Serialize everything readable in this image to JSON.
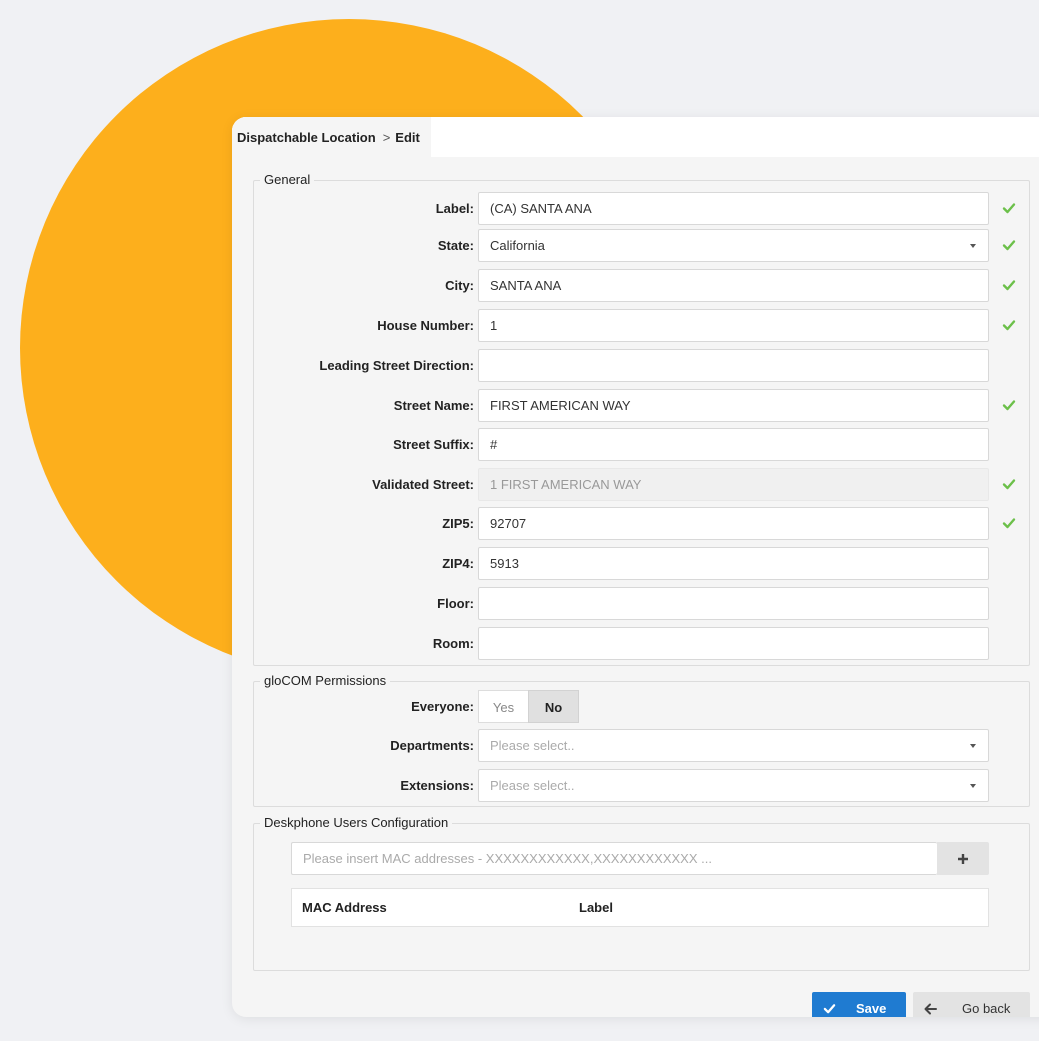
{
  "breadcrumb": {
    "root": "Dispatchable Location",
    "separator": ">",
    "current": "Edit"
  },
  "general": {
    "legend": "General",
    "fields": {
      "label": {
        "label": "Label:",
        "value": "(CA) SANTA ANA"
      },
      "state": {
        "label": "State:",
        "value": "California"
      },
      "city": {
        "label": "City:",
        "value": "SANTA ANA"
      },
      "house_number": {
        "label": "House Number:",
        "value": "1"
      },
      "leading_street_direction": {
        "label": "Leading Street Direction:",
        "value": ""
      },
      "street_name": {
        "label": "Street Name:",
        "value": "FIRST AMERICAN WAY"
      },
      "street_suffix": {
        "label": "Street Suffix:",
        "value": "#"
      },
      "validated_street": {
        "label": "Validated Street:",
        "value": "1 FIRST AMERICAN WAY"
      },
      "zip5": {
        "label": "ZIP5:",
        "value": "92707"
      },
      "zip4": {
        "label": "ZIP4:",
        "value": "5913"
      },
      "floor": {
        "label": "Floor:",
        "value": ""
      },
      "room": {
        "label": "Room:",
        "value": ""
      }
    }
  },
  "permissions": {
    "legend": "gloCOM Permissions",
    "everyone": {
      "label": "Everyone:",
      "yes": "Yes",
      "no": "No",
      "selected": "No"
    },
    "departments": {
      "label": "Departments:",
      "placeholder": "Please select.."
    },
    "extensions": {
      "label": "Extensions:",
      "placeholder": "Please select.."
    }
  },
  "deskphone": {
    "legend": "Deskphone Users Configuration",
    "mac_placeholder": "Please insert MAC addresses - XXXXXXXXXXXX,XXXXXXXXXXXX ...",
    "add_button": "+",
    "columns": [
      "MAC Address",
      "Label"
    ]
  },
  "actions": {
    "save": "Save",
    "go_back": "Go back"
  },
  "colors": {
    "accent": "#1f7bd1",
    "valid": "#6cc04a",
    "blob": "#fdaf1c"
  },
  "icons": {
    "valid": "check-icon",
    "save": "check-icon",
    "back": "arrow-left-icon",
    "add": "plus-icon"
  }
}
